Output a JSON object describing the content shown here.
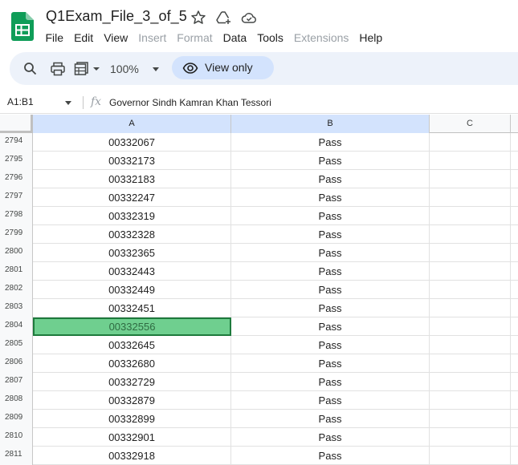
{
  "app": {
    "title": "Q1Exam_File_3_of_5",
    "menu": [
      {
        "label": "File",
        "disabled": false
      },
      {
        "label": "Edit",
        "disabled": false
      },
      {
        "label": "View",
        "disabled": false
      },
      {
        "label": "Insert",
        "disabled": true
      },
      {
        "label": "Format",
        "disabled": true
      },
      {
        "label": "Data",
        "disabled": false
      },
      {
        "label": "Tools",
        "disabled": false
      },
      {
        "label": "Extensions",
        "disabled": true
      },
      {
        "label": "Help",
        "disabled": false
      }
    ]
  },
  "toolbar": {
    "zoom": "100%",
    "view_only_label": "View only"
  },
  "formula_bar": {
    "name_box": "A1:B1",
    "fx_label": "fx",
    "content": "Governor Sindh Kamran Khan Tessori"
  },
  "grid": {
    "columns": [
      {
        "label": "A",
        "selected": true
      },
      {
        "label": "B",
        "selected": true
      },
      {
        "label": "C",
        "selected": false
      }
    ],
    "rows": [
      {
        "num": "2794",
        "a": "00332067",
        "b": "Pass"
      },
      {
        "num": "2795",
        "a": "00332173",
        "b": "Pass"
      },
      {
        "num": "2796",
        "a": "00332183",
        "b": "Pass"
      },
      {
        "num": "2797",
        "a": "00332247",
        "b": "Pass"
      },
      {
        "num": "2798",
        "a": "00332319",
        "b": "Pass"
      },
      {
        "num": "2799",
        "a": "00332328",
        "b": "Pass"
      },
      {
        "num": "2800",
        "a": "00332365",
        "b": "Pass"
      },
      {
        "num": "2801",
        "a": "00332443",
        "b": "Pass"
      },
      {
        "num": "2802",
        "a": "00332449",
        "b": "Pass"
      },
      {
        "num": "2803",
        "a": "00332451",
        "b": "Pass"
      },
      {
        "num": "2804",
        "a": "00332556",
        "b": "Pass",
        "active": true
      },
      {
        "num": "2805",
        "a": "00332645",
        "b": "Pass"
      },
      {
        "num": "2806",
        "a": "00332680",
        "b": "Pass"
      },
      {
        "num": "2807",
        "a": "00332729",
        "b": "Pass"
      },
      {
        "num": "2808",
        "a": "00332879",
        "b": "Pass"
      },
      {
        "num": "2809",
        "a": "00332899",
        "b": "Pass"
      },
      {
        "num": "2810",
        "a": "00332901",
        "b": "Pass"
      },
      {
        "num": "2811",
        "a": "00332918",
        "b": "Pass"
      }
    ]
  },
  "colors": {
    "accent": "#d3e3fd",
    "toolbar_bg": "#edf2fa",
    "active_cell": "#6fcf8f",
    "sheets_green": "#0f9d58"
  },
  "icons": {
    "logo": "google-sheets-logo",
    "star": "star-icon",
    "move": "move-to-drive-icon",
    "cloud": "cloud-status-icon",
    "search": "search-icon",
    "print": "print-icon",
    "format_paint": "print-view-icon",
    "view": "eye-icon"
  }
}
